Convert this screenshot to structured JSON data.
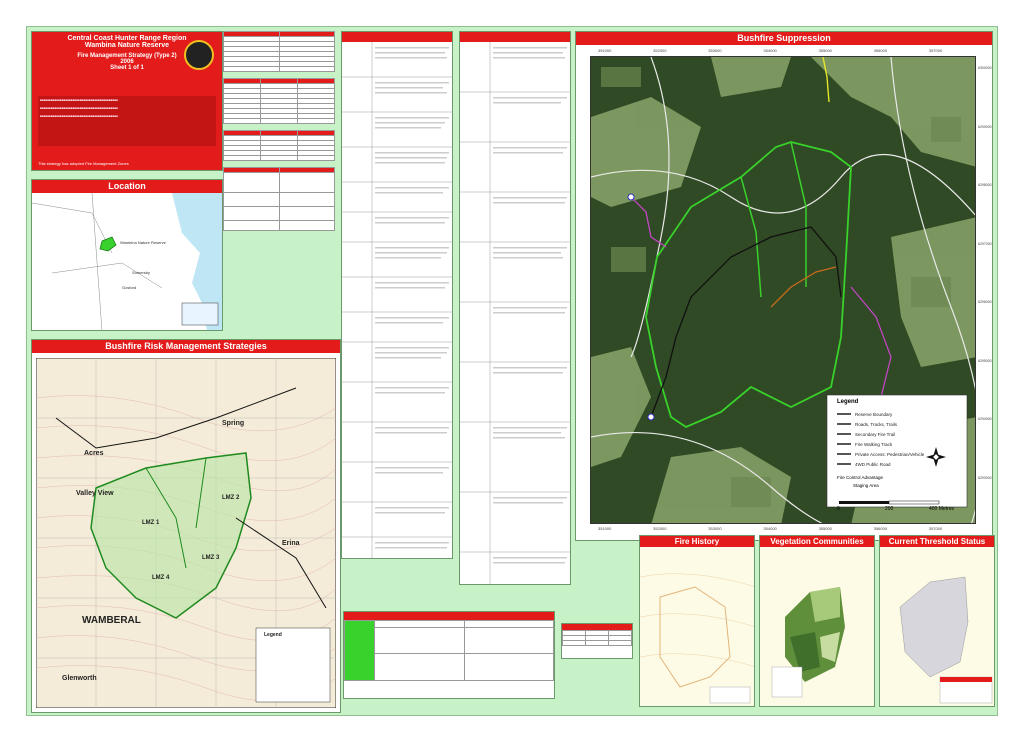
{
  "title_block": {
    "line1": "Central Coast Hunter Range Region",
    "line2": "Wambina Nature Reserve",
    "line3": "Fire Management Strategy (Type 2)",
    "line4": "2006",
    "line5": "Sheet 1 of 1",
    "footer": "This strategy has adopted Fire Management Zones"
  },
  "sections": {
    "location": "Location",
    "risk_strategies": "Bushfire Risk Management Strategies",
    "suppression": "Bushfire Suppression",
    "fire_history": "Fire History",
    "vegetation": "Vegetation Communities",
    "threshold": "Current Threshold Status"
  },
  "location_map": {
    "label_reserve": "Wambina Nature Reserve",
    "label_town1": "Somersby",
    "label_town2": "Gosford"
  },
  "risk_map": {
    "labels": [
      "Acres",
      "Valley View",
      "LMZ 1",
      "LMZ 2",
      "LMZ 3",
      "LMZ 4",
      "WAMBERAL",
      "Glenworth",
      "Erina",
      "Spring"
    ],
    "legend_title": "Legend"
  },
  "suppression_map": {
    "legend_title": "Legend",
    "legend_items": [
      {
        "label": "Reserve Boundary",
        "color": "#39d12b"
      },
      {
        "label": "Roads, Tracks, Trails",
        "color": "#ffffff"
      },
      {
        "label": "Secondary Fire Trail",
        "color": "#111111"
      },
      {
        "label": "Fire Walking Track",
        "color": "#c245c2"
      },
      {
        "label": "Private Access: Pedestrian/Vehicle",
        "color": "#c86a1e"
      },
      {
        "label": "4WD Public Road",
        "color": "#e6e62c"
      }
    ],
    "extra_legend": "Fire Control Advantage",
    "extra_legend2": "Staging Area",
    "scale_labels": [
      "0",
      "200",
      "400 Metres"
    ],
    "top_ticks": [
      "351000",
      "352000",
      "353000",
      "354000",
      "355000",
      "356000",
      "357000"
    ],
    "bottom_ticks": [
      "351000",
      "352000",
      "353000",
      "354000",
      "355000",
      "356000",
      "357000"
    ],
    "right_ticks": [
      "6300000",
      "6299000",
      "6298000",
      "6297000",
      "6296000",
      "6295000",
      "6294000",
      "6293000"
    ]
  },
  "colors": {
    "header_red": "#e31b1b",
    "sheet_green": "#c7f2c7",
    "reserve_green": "#39d12b",
    "track_purple": "#c245c2"
  }
}
